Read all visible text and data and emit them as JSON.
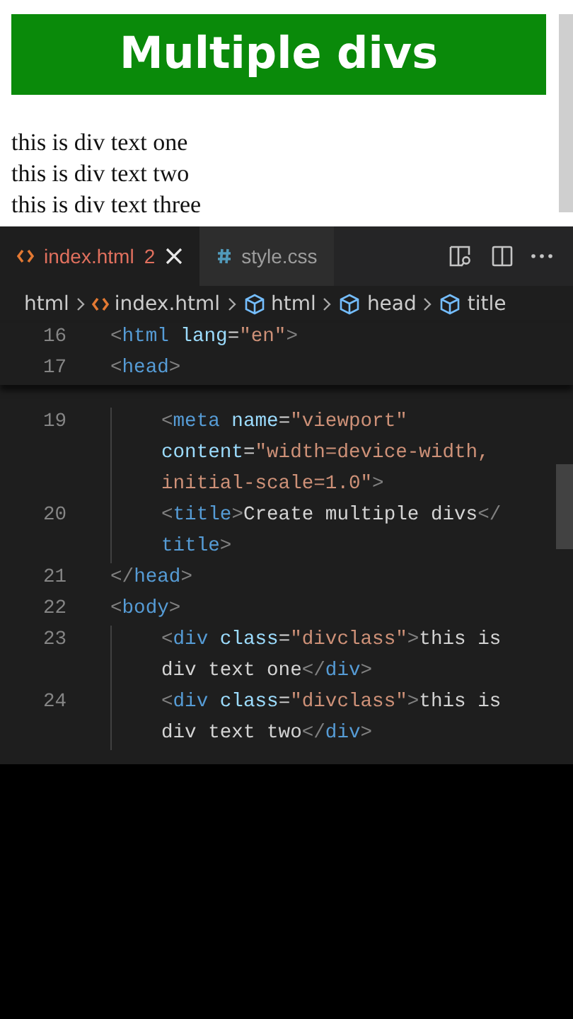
{
  "preview": {
    "heading": "Multiple divs",
    "lines": [
      "this is div text one",
      "this is div text two",
      "this is div text three"
    ]
  },
  "editor": {
    "tabs": [
      {
        "label": "index.html",
        "badge": "2",
        "kind": "html",
        "selected": true
      },
      {
        "label": "style.css",
        "kind": "css",
        "selected": false
      }
    ],
    "breadcrumb": [
      {
        "label": "html",
        "kind": "folder"
      },
      {
        "label": "index.html",
        "kind": "file"
      },
      {
        "label": "html",
        "kind": "element"
      },
      {
        "label": "head",
        "kind": "element"
      },
      {
        "label": "title",
        "kind": "element"
      }
    ],
    "sticky_lines": [
      {
        "number": "16",
        "rows": [
          {
            "segments": [
              {
                "kind": "punct",
                "text": "<"
              },
              {
                "kind": "tag",
                "text": "html"
              },
              {
                "kind": "attr",
                "text": " lang"
              },
              {
                "kind": "plain",
                "text": "="
              },
              {
                "kind": "string",
                "text": "\"en\""
              },
              {
                "kind": "punct",
                "text": ">"
              }
            ]
          }
        ]
      },
      {
        "number": "17",
        "rows": [
          {
            "segments": [
              {
                "kind": "punct",
                "text": "<"
              },
              {
                "kind": "tag",
                "text": "head"
              },
              {
                "kind": "punct",
                "text": ">"
              }
            ]
          }
        ]
      }
    ],
    "lines": [
      {
        "kind": "block",
        "children": [
          {
            "kind": "line",
            "number": "19",
            "rows": [
              {
                "segments": [
                  {
                    "kind": "punct",
                    "text": "<"
                  },
                  {
                    "kind": "tag",
                    "text": "meta"
                  },
                  {
                    "kind": "attr",
                    "text": " name"
                  },
                  {
                    "kind": "plain",
                    "text": "="
                  },
                  {
                    "kind": "string",
                    "text": "\"viewport\""
                  }
                ]
              },
              {
                "segments": [
                  {
                    "kind": "attr",
                    "text": "content"
                  },
                  {
                    "kind": "plain",
                    "text": "="
                  },
                  {
                    "kind": "string",
                    "text": "\"width=device-width,"
                  }
                ]
              },
              {
                "segments": [
                  {
                    "kind": "string",
                    "text": "initial-scale=1.0\""
                  },
                  {
                    "kind": "punct",
                    "text": ">"
                  }
                ]
              }
            ]
          },
          {
            "kind": "line",
            "number": "20",
            "rows": [
              {
                "segments": [
                  {
                    "kind": "punct",
                    "text": "<"
                  },
                  {
                    "kind": "tag",
                    "text": "title"
                  },
                  {
                    "kind": "punct",
                    "text": ">"
                  },
                  {
                    "kind": "plain",
                    "text": "Create multiple divs"
                  },
                  {
                    "kind": "punct",
                    "text": "</"
                  }
                ]
              },
              {
                "segments": [
                  {
                    "kind": "tag",
                    "text": "title"
                  },
                  {
                    "kind": "punct",
                    "text": ">"
                  }
                ]
              }
            ]
          }
        ]
      },
      {
        "kind": "line",
        "number": "21",
        "rows": [
          {
            "segments": [
              {
                "kind": "punct",
                "text": "</"
              },
              {
                "kind": "tag",
                "text": "head"
              },
              {
                "kind": "punct",
                "text": ">"
              }
            ]
          }
        ]
      },
      {
        "kind": "line",
        "number": "22",
        "rows": [
          {
            "segments": [
              {
                "kind": "punct",
                "text": "<"
              },
              {
                "kind": "tag",
                "text": "body"
              },
              {
                "kind": "punct",
                "text": ">"
              }
            ]
          }
        ]
      },
      {
        "kind": "block",
        "children": [
          {
            "kind": "line",
            "number": "23",
            "rows": [
              {
                "segments": [
                  {
                    "kind": "punct",
                    "text": "<"
                  },
                  {
                    "kind": "tag",
                    "text": "div"
                  },
                  {
                    "kind": "attr",
                    "text": " class"
                  },
                  {
                    "kind": "plain",
                    "text": "="
                  },
                  {
                    "kind": "string",
                    "text": "\"divclass\""
                  },
                  {
                    "kind": "punct",
                    "text": ">"
                  },
                  {
                    "kind": "plain",
                    "text": "this is"
                  }
                ]
              },
              {
                "segments": [
                  {
                    "kind": "plain",
                    "text": "div text one"
                  },
                  {
                    "kind": "punct",
                    "text": "</"
                  },
                  {
                    "kind": "tag",
                    "text": "div"
                  },
                  {
                    "kind": "punct",
                    "text": ">"
                  }
                ]
              }
            ]
          },
          {
            "kind": "line",
            "number": "24",
            "rows": [
              {
                "segments": [
                  {
                    "kind": "punct",
                    "text": "<"
                  },
                  {
                    "kind": "tag",
                    "text": "div"
                  },
                  {
                    "kind": "attr",
                    "text": " class"
                  },
                  {
                    "kind": "plain",
                    "text": "="
                  },
                  {
                    "kind": "string",
                    "text": "\"divclass\""
                  },
                  {
                    "kind": "punct",
                    "text": ">"
                  },
                  {
                    "kind": "plain",
                    "text": "this is"
                  }
                ]
              },
              {
                "segments": [
                  {
                    "kind": "plain",
                    "text": "div text two"
                  },
                  {
                    "kind": "punct",
                    "text": "</"
                  },
                  {
                    "kind": "tag",
                    "text": "div"
                  },
                  {
                    "kind": "punct",
                    "text": ">"
                  }
                ]
              }
            ]
          }
        ]
      }
    ]
  }
}
